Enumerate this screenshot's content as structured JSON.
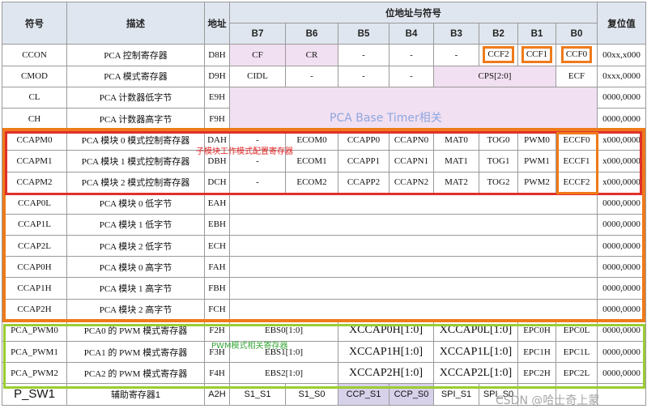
{
  "header": {
    "symbol": "符号",
    "description": "描述",
    "address": "地址",
    "bit_address_symbol": "位地址与符号",
    "reset_value": "复位值",
    "bits": [
      "B7",
      "B6",
      "B5",
      "B4",
      "B3",
      "B2",
      "B1",
      "B0"
    ]
  },
  "rows": [
    {
      "symbol": "CCON",
      "description": "PCA 控制寄存器",
      "address": "D8H",
      "b7": "CF",
      "b6": "CR",
      "b5": "-",
      "b4": "-",
      "b3": "-",
      "b2": "CCF2",
      "b1": "CCF1",
      "b0": "CCF0",
      "reset": "00xx,x000"
    },
    {
      "symbol": "CMOD",
      "description": "PCA 模式寄存器",
      "address": "D9H",
      "b7": "CIDL",
      "b6": "-",
      "b5": "-",
      "b4": "-",
      "b321": "CPS[2:0]",
      "b0": "ECF",
      "reset": "0xxx,0000"
    },
    {
      "symbol": "CL",
      "description": "PCA 计数器低字节",
      "address": "E9H",
      "reset": "0000,0000"
    },
    {
      "symbol": "CH",
      "description": "PCA 计数器高字节",
      "address": "F9H",
      "reset": "0000,0000"
    },
    {
      "symbol": "CCAPM0",
      "description": "PCA 模块 0 模式控制寄存器",
      "address": "DAH",
      "b7": "-",
      "b6": "ECOM0",
      "b5": "CCAPP0",
      "b4": "CCAPN0",
      "b3": "MAT0",
      "b2": "TOG0",
      "b1": "PWM0",
      "b0": "ECCF0",
      "reset": "x000,0000"
    },
    {
      "symbol": "CCAPM1",
      "description": "PCA 模块 1 模式控制寄存器",
      "address": "DBH",
      "b7": "-",
      "b6": "ECOM1",
      "b5": "CCAPP1",
      "b4": "CCAPN1",
      "b3": "MAT1",
      "b2": "TOG1",
      "b1": "PWM1",
      "b0": "ECCF1",
      "reset": "x000,0000"
    },
    {
      "symbol": "CCAPM2",
      "description": "PCA 模块 2 模式控制寄存器",
      "address": "DCH",
      "b7": "-",
      "b6": "ECOM2",
      "b5": "CCAPP2",
      "b4": "CCAPN2",
      "b3": "MAT2",
      "b2": "TOG2",
      "b1": "PWM2",
      "b0": "ECCF2",
      "reset": "x000,0000"
    },
    {
      "symbol": "CCAP0L",
      "description": "PCA 模块 0 低字节",
      "address": "EAH",
      "reset": "0000,0000"
    },
    {
      "symbol": "CCAP1L",
      "description": "PCA 模块 1 低字节",
      "address": "EBH",
      "reset": "0000,0000"
    },
    {
      "symbol": "CCAP2L",
      "description": "PCA 模块 2 低字节",
      "address": "ECH",
      "reset": "0000,0000"
    },
    {
      "symbol": "CCAP0H",
      "description": "PCA 模块 0 高字节",
      "address": "FAH",
      "reset": "0000,0000"
    },
    {
      "symbol": "CCAP1H",
      "description": "PCA 模块 1 高字节",
      "address": "FBH",
      "reset": "0000,0000"
    },
    {
      "symbol": "CCAP2H",
      "description": "PCA 模块 2 高字节",
      "address": "FCH",
      "reset": "0000,0000"
    },
    {
      "symbol": "PCA_PWM0",
      "description": "PCA0 的 PWM 模式寄存器",
      "address": "F2H",
      "b76": "EBS0[1:0]",
      "b54": "XCCAP0H[1:0]",
      "b32": "XCCAP0L[1:0]",
      "b1": "EPC0H",
      "b0": "EPC0L",
      "reset": "0000,0000"
    },
    {
      "symbol": "PCA_PWM1",
      "description": "PCA1 的 PWM 模式寄存器",
      "address": "F3H",
      "b76": "EBS1[1:0]",
      "b54": "XCCAP1H[1:0]",
      "b32": "XCCAP1L[1:0]",
      "b1": "EPC1H",
      "b0": "EPC1L",
      "reset": "0000,0000"
    },
    {
      "symbol": "PCA_PWM2",
      "description": "PCA2 的 PWM 模式寄存器",
      "address": "F4H",
      "b76": "EBS2[1:0]",
      "b54": "XCCAP2H[1:0]",
      "b32": "XCCAP2L[1:0]",
      "b1": "EPC2H",
      "b0": "EPC2L",
      "reset": "0000,0000"
    },
    {
      "symbol": "P_SW1",
      "description": "辅助寄存器1",
      "address": "A2H",
      "b7": "S1_S1",
      "b6": "S1_S0",
      "b5": "CCP_S1",
      "b4": "CCP_S0",
      "b3": "SPI_S1",
      "b2": "SPI_S0"
    }
  ],
  "annotations": {
    "base_timer": "PCA Base Timer相关",
    "submodule_mode": "子模块工作模式配置寄存器",
    "pwm_mode": "PWM模式相关寄存器",
    "watermark": "CSDN @哈士奇上蒙"
  },
  "colors": {
    "header_bg": "#dfe6ef",
    "pink_cell": "#f1e0f1",
    "purple_cell": "#d7d1ea",
    "orange_box": "#ef7a1a",
    "red_box": "#e0302a",
    "green_box": "#9acd32",
    "base_timer_text": "#8fa6e0"
  }
}
